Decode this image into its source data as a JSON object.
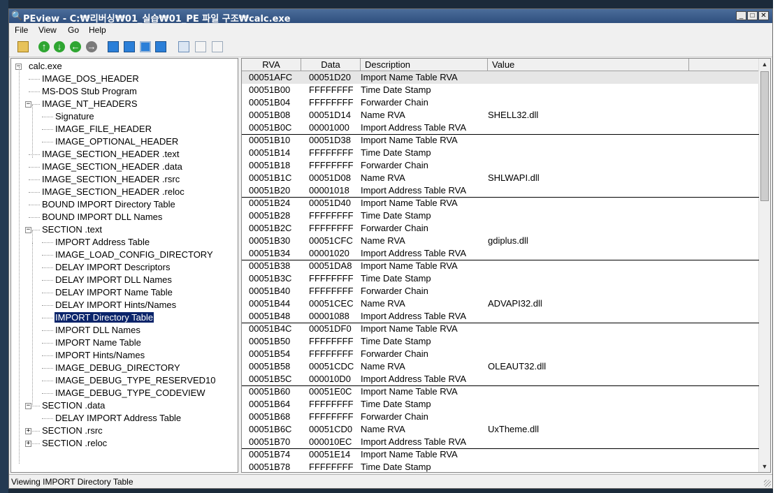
{
  "window": {
    "title": "PEview - C:₩리버싱₩01_실습₩01_PE 파일 구조₩calc.exe",
    "buttons": {
      "minimize": "_",
      "maximize": "□",
      "close": "✕"
    }
  },
  "menu": [
    "File",
    "View",
    "Go",
    "Help"
  ],
  "toolbar": {
    "icons": [
      "open-folder-icon",
      "up-arrow-icon",
      "down-arrow-icon",
      "back-arrow-icon",
      "forward-arrow-icon",
      "jump-previous-icon",
      "jump-next-icon",
      "jump-up-icon",
      "jump-down-icon",
      "view-byte-icon",
      "view-word-icon",
      "view-dword-icon"
    ]
  },
  "tree": [
    {
      "label": "calc.exe",
      "expander": "−"
    },
    {
      "label": "IMAGE_DOS_HEADER"
    },
    {
      "label": "MS-DOS Stub Program"
    },
    {
      "label": "IMAGE_NT_HEADERS",
      "expander": "−"
    },
    {
      "label": "Signature"
    },
    {
      "label": "IMAGE_FILE_HEADER"
    },
    {
      "label": "IMAGE_OPTIONAL_HEADER"
    },
    {
      "label": "IMAGE_SECTION_HEADER .text"
    },
    {
      "label": "IMAGE_SECTION_HEADER .data"
    },
    {
      "label": "IMAGE_SECTION_HEADER .rsrc"
    },
    {
      "label": "IMAGE_SECTION_HEADER .reloc"
    },
    {
      "label": "BOUND IMPORT Directory Table"
    },
    {
      "label": "BOUND IMPORT DLL Names"
    },
    {
      "label": "SECTION .text",
      "expander": "−"
    },
    {
      "label": "IMPORT Address Table"
    },
    {
      "label": "IMAGE_LOAD_CONFIG_DIRECTORY"
    },
    {
      "label": "DELAY IMPORT Descriptors"
    },
    {
      "label": "DELAY IMPORT DLL Names"
    },
    {
      "label": "DELAY IMPORT Name Table"
    },
    {
      "label": "DELAY IMPORT Hints/Names"
    },
    {
      "label": "IMPORT Directory Table",
      "selected": true
    },
    {
      "label": "IMPORT DLL Names"
    },
    {
      "label": "IMPORT Name Table"
    },
    {
      "label": "IMPORT Hints/Names"
    },
    {
      "label": "IMAGE_DEBUG_DIRECTORY"
    },
    {
      "label": "IMAGE_DEBUG_TYPE_RESERVED10"
    },
    {
      "label": "IMAGE_DEBUG_TYPE_CODEVIEW"
    },
    {
      "label": "SECTION .data",
      "expander": "−"
    },
    {
      "label": "DELAY IMPORT Address Table"
    },
    {
      "label": "SECTION .rsrc",
      "expander": "+"
    },
    {
      "label": "SECTION .reloc",
      "expander": "+"
    }
  ],
  "table": {
    "columns": [
      "RVA",
      "Data",
      "Description",
      "Value"
    ],
    "rows": [
      [
        "00051AFC",
        "00051D20",
        "Import Name Table RVA",
        ""
      ],
      [
        "00051B00",
        "FFFFFFFF",
        "Time Date Stamp",
        ""
      ],
      [
        "00051B04",
        "FFFFFFFF",
        "Forwarder Chain",
        ""
      ],
      [
        "00051B08",
        "00051D14",
        "Name RVA",
        "SHELL32.dll"
      ],
      [
        "00051B0C",
        "00001000",
        "Import Address Table RVA",
        ""
      ],
      [
        "00051B10",
        "00051D38",
        "Import Name Table RVA",
        ""
      ],
      [
        "00051B14",
        "FFFFFFFF",
        "Time Date Stamp",
        ""
      ],
      [
        "00051B18",
        "FFFFFFFF",
        "Forwarder Chain",
        ""
      ],
      [
        "00051B1C",
        "00051D08",
        "Name RVA",
        "SHLWAPI.dll"
      ],
      [
        "00051B20",
        "00001018",
        "Import Address Table RVA",
        ""
      ],
      [
        "00051B24",
        "00051D40",
        "Import Name Table RVA",
        ""
      ],
      [
        "00051B28",
        "FFFFFFFF",
        "Time Date Stamp",
        ""
      ],
      [
        "00051B2C",
        "FFFFFFFF",
        "Forwarder Chain",
        ""
      ],
      [
        "00051B30",
        "00051CFC",
        "Name RVA",
        "gdiplus.dll"
      ],
      [
        "00051B34",
        "00001020",
        "Import Address Table RVA",
        ""
      ],
      [
        "00051B38",
        "00051DA8",
        "Import Name Table RVA",
        ""
      ],
      [
        "00051B3C",
        "FFFFFFFF",
        "Time Date Stamp",
        ""
      ],
      [
        "00051B40",
        "FFFFFFFF",
        "Forwarder Chain",
        ""
      ],
      [
        "00051B44",
        "00051CEC",
        "Name RVA",
        "ADVAPI32.dll"
      ],
      [
        "00051B48",
        "00001088",
        "Import Address Table RVA",
        ""
      ],
      [
        "00051B4C",
        "00051DF0",
        "Import Name Table RVA",
        ""
      ],
      [
        "00051B50",
        "FFFFFFFF",
        "Time Date Stamp",
        ""
      ],
      [
        "00051B54",
        "FFFFFFFF",
        "Forwarder Chain",
        ""
      ],
      [
        "00051B58",
        "00051CDC",
        "Name RVA",
        "OLEAUT32.dll"
      ],
      [
        "00051B5C",
        "000010D0",
        "Import Address Table RVA",
        ""
      ],
      [
        "00051B60",
        "00051E0C",
        "Import Name Table RVA",
        ""
      ],
      [
        "00051B64",
        "FFFFFFFF",
        "Time Date Stamp",
        ""
      ],
      [
        "00051B68",
        "FFFFFFFF",
        "Forwarder Chain",
        ""
      ],
      [
        "00051B6C",
        "00051CD0",
        "Name RVA",
        "UxTheme.dll"
      ],
      [
        "00051B70",
        "000010EC",
        "Import Address Table RVA",
        ""
      ],
      [
        "00051B74",
        "00051E14",
        "Import Name Table RVA",
        ""
      ],
      [
        "00051B78",
        "FFFFFFFF",
        "Time Date Stamp",
        ""
      ]
    ]
  },
  "scrollbar": {
    "up": "▲",
    "down": "▼"
  },
  "status": "Viewing IMPORT Directory Table",
  "colors": {
    "selection": "#0a246a",
    "titlebar": "#2f4f7e"
  }
}
